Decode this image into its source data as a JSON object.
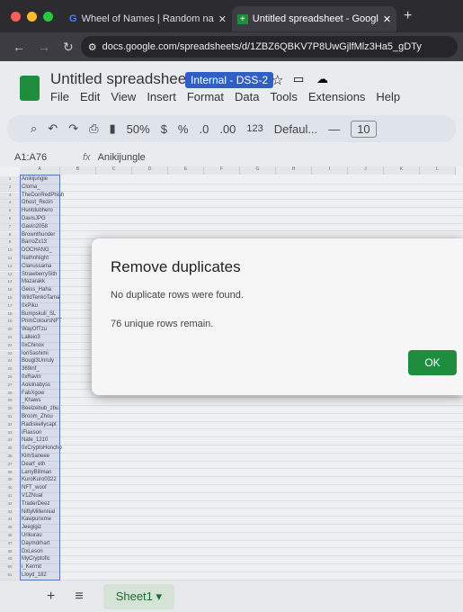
{
  "browser": {
    "tabs": [
      {
        "label": "Wheel of Names | Random na"
      },
      {
        "label": "Untitled spreadsheet - Googl"
      }
    ],
    "url": "docs.google.com/spreadsheets/d/1ZBZ6QBKV7P8UwGjlfMlz3Ha5_gDTy"
  },
  "doc": {
    "title": "Untitled spreadsheet",
    "badge": "Internal - DSS-2",
    "menu": [
      "File",
      "Edit",
      "View",
      "Insert",
      "Format",
      "Data",
      "Tools",
      "Extensions",
      "Help"
    ]
  },
  "toolbar": {
    "zoom": "50%",
    "currency": "$",
    "percent": "%",
    "dec_down": ".0",
    "dec_up": ".00",
    "number": "123",
    "font": "Defaul...",
    "font_size": "10"
  },
  "formula_bar": {
    "range": "A1:A76",
    "value": "Anikijungle"
  },
  "columns": [
    "A",
    "B",
    "C",
    "D",
    "E",
    "F",
    "G",
    "H",
    "I",
    "J",
    "K",
    "L"
  ],
  "cells": [
    "Anikijungle",
    "Cloma_",
    "TheDonRedPhish",
    "Ghost_Rezin",
    "Huntdubhero",
    "DavisJPG",
    "Gavin2058",
    "Brownthunder",
    "BarroZx13",
    "DOCHANG_",
    "NathnNight",
    "Clanussama",
    "StrawberrySith",
    "Mazarakk",
    "Geiss_Haha",
    "WildTenkoTama",
    "0xPiku",
    "Bumpskull_SL",
    "PrimColoursNFT",
    "WayOfTzu",
    "Lalleio3",
    "0xChinox",
    "IoriSashimi",
    "Bougi3Unruly",
    "369inf_",
    "0xRavin",
    "Aokiinabyss",
    "FabXgow",
    "_Khaws",
    "Beelzebub_zbu",
    "Broom_Zhou",
    "Radiskellycapt",
    "iFlaxson",
    "Nate_1210",
    "0xCryptoHoncho",
    "KimSaneee",
    "Dearf_eth",
    "LarryBillman",
    "KuroKuro0322",
    "NFT_woof",
    "V1ZNual",
    "TraderDeez",
    "NiftyMillennial",
    "Kawpunxme",
    "Jeegigiz",
    "Urikurau",
    "Daymdrhart",
    "DxLeson",
    "MyCryptofic",
    "i_Kermit",
    "Lloyd_182"
  ],
  "dialog": {
    "title": "Remove duplicates",
    "message": "No duplicate rows were found.",
    "detail": "76 unique rows remain.",
    "ok": "OK"
  },
  "bottom": {
    "add": "+",
    "list": "≡",
    "sheet": "Sheet1",
    "caret": "▾"
  }
}
